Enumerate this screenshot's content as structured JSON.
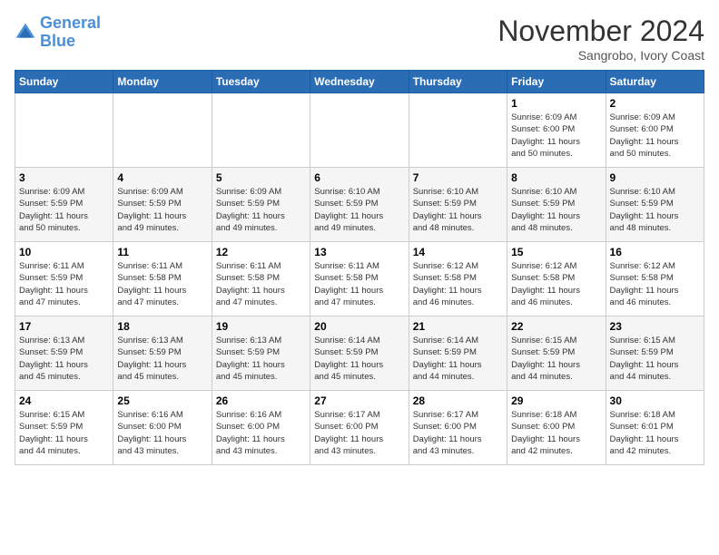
{
  "header": {
    "logo_line1": "General",
    "logo_line2": "Blue",
    "month": "November 2024",
    "location": "Sangrobo, Ivory Coast"
  },
  "weekdays": [
    "Sunday",
    "Monday",
    "Tuesday",
    "Wednesday",
    "Thursday",
    "Friday",
    "Saturday"
  ],
  "weeks": [
    [
      {
        "day": "",
        "info": ""
      },
      {
        "day": "",
        "info": ""
      },
      {
        "day": "",
        "info": ""
      },
      {
        "day": "",
        "info": ""
      },
      {
        "day": "",
        "info": ""
      },
      {
        "day": "1",
        "info": "Sunrise: 6:09 AM\nSunset: 6:00 PM\nDaylight: 11 hours\nand 50 minutes."
      },
      {
        "day": "2",
        "info": "Sunrise: 6:09 AM\nSunset: 6:00 PM\nDaylight: 11 hours\nand 50 minutes."
      }
    ],
    [
      {
        "day": "3",
        "info": "Sunrise: 6:09 AM\nSunset: 5:59 PM\nDaylight: 11 hours\nand 50 minutes."
      },
      {
        "day": "4",
        "info": "Sunrise: 6:09 AM\nSunset: 5:59 PM\nDaylight: 11 hours\nand 49 minutes."
      },
      {
        "day": "5",
        "info": "Sunrise: 6:09 AM\nSunset: 5:59 PM\nDaylight: 11 hours\nand 49 minutes."
      },
      {
        "day": "6",
        "info": "Sunrise: 6:10 AM\nSunset: 5:59 PM\nDaylight: 11 hours\nand 49 minutes."
      },
      {
        "day": "7",
        "info": "Sunrise: 6:10 AM\nSunset: 5:59 PM\nDaylight: 11 hours\nand 48 minutes."
      },
      {
        "day": "8",
        "info": "Sunrise: 6:10 AM\nSunset: 5:59 PM\nDaylight: 11 hours\nand 48 minutes."
      },
      {
        "day": "9",
        "info": "Sunrise: 6:10 AM\nSunset: 5:59 PM\nDaylight: 11 hours\nand 48 minutes."
      }
    ],
    [
      {
        "day": "10",
        "info": "Sunrise: 6:11 AM\nSunset: 5:59 PM\nDaylight: 11 hours\nand 47 minutes."
      },
      {
        "day": "11",
        "info": "Sunrise: 6:11 AM\nSunset: 5:58 PM\nDaylight: 11 hours\nand 47 minutes."
      },
      {
        "day": "12",
        "info": "Sunrise: 6:11 AM\nSunset: 5:58 PM\nDaylight: 11 hours\nand 47 minutes."
      },
      {
        "day": "13",
        "info": "Sunrise: 6:11 AM\nSunset: 5:58 PM\nDaylight: 11 hours\nand 47 minutes."
      },
      {
        "day": "14",
        "info": "Sunrise: 6:12 AM\nSunset: 5:58 PM\nDaylight: 11 hours\nand 46 minutes."
      },
      {
        "day": "15",
        "info": "Sunrise: 6:12 AM\nSunset: 5:58 PM\nDaylight: 11 hours\nand 46 minutes."
      },
      {
        "day": "16",
        "info": "Sunrise: 6:12 AM\nSunset: 5:58 PM\nDaylight: 11 hours\nand 46 minutes."
      }
    ],
    [
      {
        "day": "17",
        "info": "Sunrise: 6:13 AM\nSunset: 5:59 PM\nDaylight: 11 hours\nand 45 minutes."
      },
      {
        "day": "18",
        "info": "Sunrise: 6:13 AM\nSunset: 5:59 PM\nDaylight: 11 hours\nand 45 minutes."
      },
      {
        "day": "19",
        "info": "Sunrise: 6:13 AM\nSunset: 5:59 PM\nDaylight: 11 hours\nand 45 minutes."
      },
      {
        "day": "20",
        "info": "Sunrise: 6:14 AM\nSunset: 5:59 PM\nDaylight: 11 hours\nand 45 minutes."
      },
      {
        "day": "21",
        "info": "Sunrise: 6:14 AM\nSunset: 5:59 PM\nDaylight: 11 hours\nand 44 minutes."
      },
      {
        "day": "22",
        "info": "Sunrise: 6:15 AM\nSunset: 5:59 PM\nDaylight: 11 hours\nand 44 minutes."
      },
      {
        "day": "23",
        "info": "Sunrise: 6:15 AM\nSunset: 5:59 PM\nDaylight: 11 hours\nand 44 minutes."
      }
    ],
    [
      {
        "day": "24",
        "info": "Sunrise: 6:15 AM\nSunset: 5:59 PM\nDaylight: 11 hours\nand 44 minutes."
      },
      {
        "day": "25",
        "info": "Sunrise: 6:16 AM\nSunset: 6:00 PM\nDaylight: 11 hours\nand 43 minutes."
      },
      {
        "day": "26",
        "info": "Sunrise: 6:16 AM\nSunset: 6:00 PM\nDaylight: 11 hours\nand 43 minutes."
      },
      {
        "day": "27",
        "info": "Sunrise: 6:17 AM\nSunset: 6:00 PM\nDaylight: 11 hours\nand 43 minutes."
      },
      {
        "day": "28",
        "info": "Sunrise: 6:17 AM\nSunset: 6:00 PM\nDaylight: 11 hours\nand 43 minutes."
      },
      {
        "day": "29",
        "info": "Sunrise: 6:18 AM\nSunset: 6:00 PM\nDaylight: 11 hours\nand 42 minutes."
      },
      {
        "day": "30",
        "info": "Sunrise: 6:18 AM\nSunset: 6:01 PM\nDaylight: 11 hours\nand 42 minutes."
      }
    ]
  ]
}
